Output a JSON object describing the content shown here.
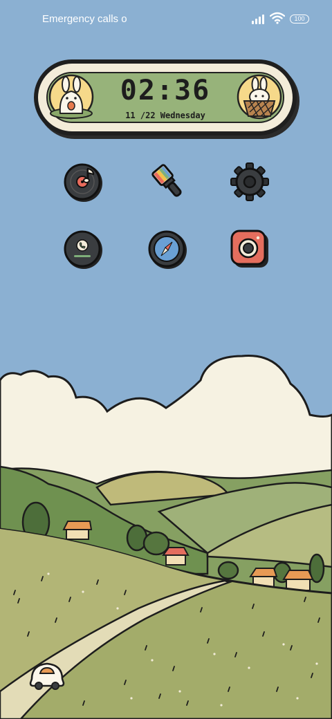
{
  "status_bar": {
    "carrier_text": "Emergency calls o",
    "battery_level": "100"
  },
  "clock_widget": {
    "time": "02:36",
    "date": "11 /22 Wednesday"
  },
  "apps": [
    {
      "name": "music",
      "icon": "music-record-icon"
    },
    {
      "name": "themes",
      "icon": "paint-brush-icon"
    },
    {
      "name": "settings",
      "icon": "gear-icon"
    },
    {
      "name": "phone",
      "icon": "phone-icon"
    },
    {
      "name": "browser",
      "icon": "compass-icon"
    },
    {
      "name": "camera",
      "icon": "camera-icon"
    }
  ],
  "colors": {
    "sky": "#8bb0d2",
    "widget_green": "#97b37a",
    "cream": "#f3ecd9",
    "outline": "#1f1f1f"
  }
}
